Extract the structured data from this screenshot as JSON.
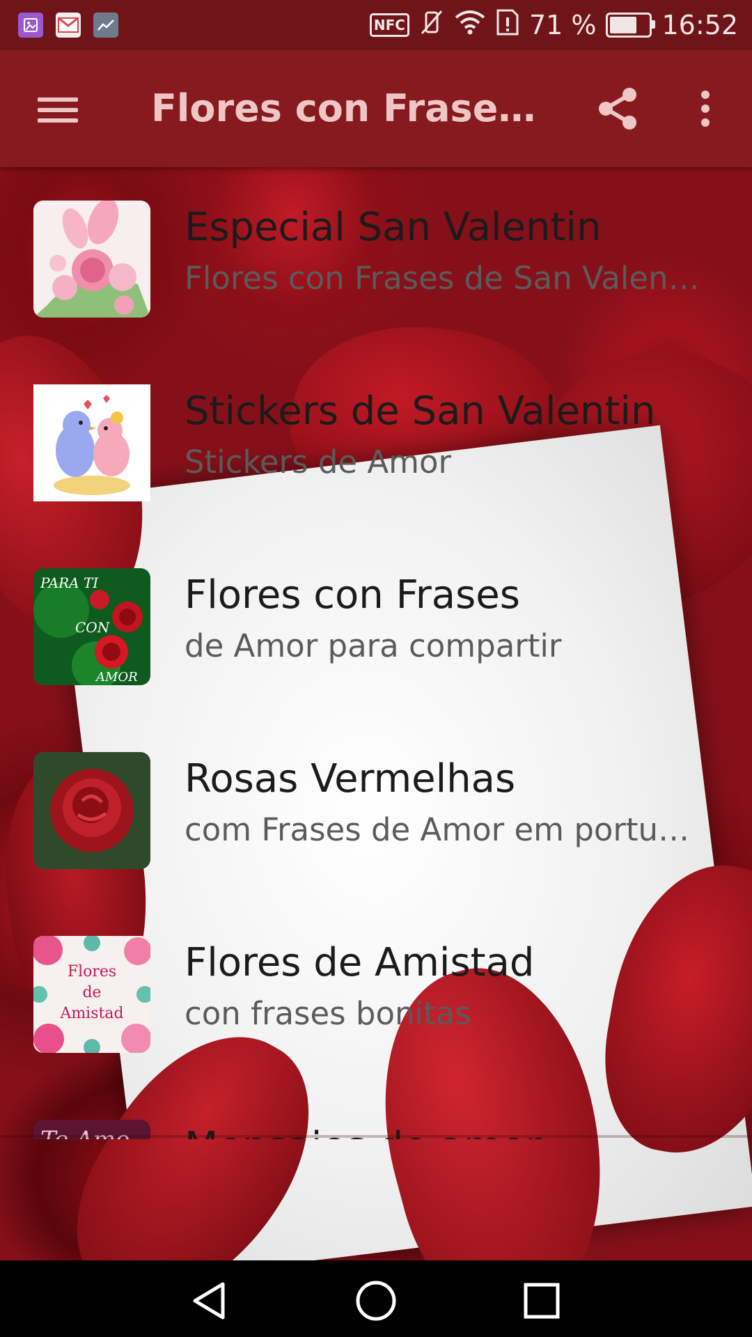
{
  "status_bar": {
    "battery_percent": "71 %",
    "battery_level": 0.71,
    "time": "16:52",
    "nfc_label": "NFC"
  },
  "app_bar": {
    "title": "Flores con Frases de Amor",
    "menu_icon": "hamburger-menu-icon",
    "share_icon": "share-icon",
    "more_icon": "more-vert-icon"
  },
  "list": {
    "items": [
      {
        "title": "Especial San Valentin",
        "subtitle": "Flores con Frases de San Valentin",
        "icon": "pink-roses-thumb"
      },
      {
        "title": "Stickers de San Valentin",
        "subtitle": "Stickers de Amor",
        "icon": "love-birds-thumb"
      },
      {
        "title": "Flores con Frases",
        "subtitle": "de Amor para compartir",
        "icon": "para-ti-con-amor-thumb",
        "thumb_text": [
          "PARA TI",
          "CON",
          "AMOR"
        ]
      },
      {
        "title": "Rosas Vermelhas",
        "subtitle": "com Frases de Amor em portugues",
        "icon": "red-rose-thumb"
      },
      {
        "title": "Flores de Amistad",
        "subtitle": "con frases bonitas",
        "icon": "flores-de-amistad-thumb",
        "thumb_text": [
          "Flores",
          "de",
          "Amistad"
        ]
      },
      {
        "title": "Mensajes de amor",
        "subtitle": "",
        "icon": "te-amo-thumb",
        "thumb_text": [
          "Te Amo"
        ]
      }
    ]
  },
  "colors": {
    "status_bar": "#6f1418",
    "app_bar": "#871a1f",
    "app_bar_text": "#efc6c6"
  }
}
